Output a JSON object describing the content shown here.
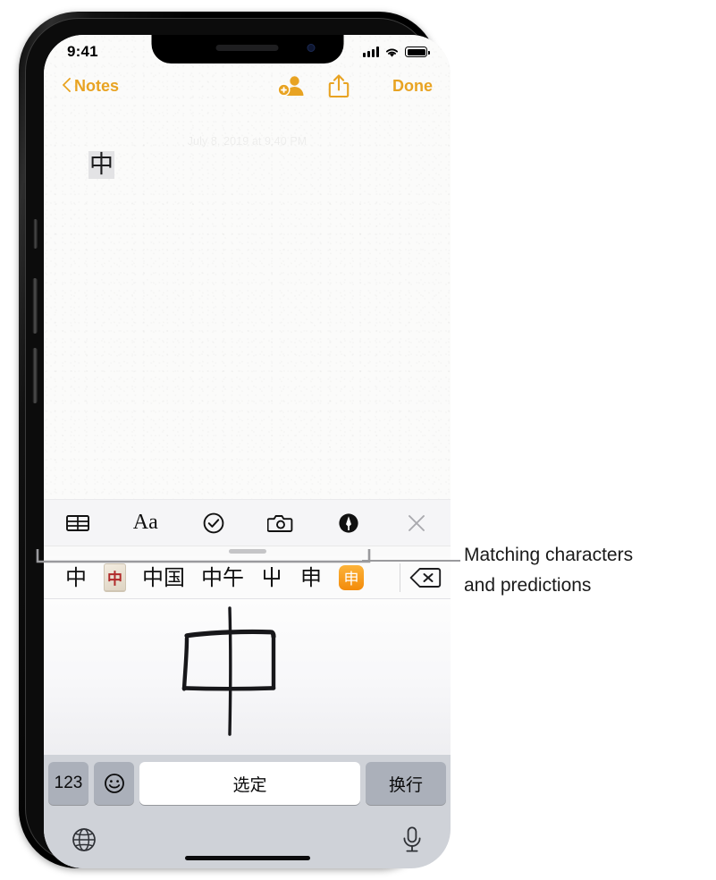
{
  "status_bar": {
    "time": "9:41",
    "signal_icon": "cellular-signal-icon",
    "wifi_icon": "wifi-icon",
    "battery_icon": "battery-icon"
  },
  "navbar": {
    "back_label": "Notes",
    "back_icon": "chevron-left-icon",
    "add_people_icon": "add-person-icon",
    "share_icon": "share-icon",
    "done_label": "Done"
  },
  "note": {
    "date": "July 8, 2019 at 9:40 PM",
    "body_text": "中"
  },
  "note_toolbar": {
    "items": [
      {
        "name": "table-icon",
        "label": ""
      },
      {
        "name": "format-icon",
        "label": "Aa"
      },
      {
        "name": "checklist-icon",
        "label": ""
      },
      {
        "name": "camera-icon",
        "label": ""
      },
      {
        "name": "markup-icon",
        "label": ""
      },
      {
        "name": "close-icon",
        "label": ""
      }
    ]
  },
  "candidate_bar": {
    "grabber": "drag-handle",
    "candidates": [
      {
        "type": "text",
        "label": "中"
      },
      {
        "type": "mahjong",
        "label": "中"
      },
      {
        "type": "text",
        "label": "中国"
      },
      {
        "type": "text",
        "label": "中午"
      },
      {
        "type": "text",
        "label": "屮"
      },
      {
        "type": "text",
        "label": "申"
      },
      {
        "type": "emoji",
        "label": "申"
      }
    ],
    "delete_icon": "delete-backward-icon"
  },
  "handwriting_pad": {
    "drawn_character": "中"
  },
  "keyboard": {
    "numeric_key": "123",
    "emoji_key_icon": "smiley-icon",
    "space_key": "选定",
    "return_key": "换行",
    "globe_icon": "globe-icon",
    "mic_icon": "microphone-icon"
  },
  "callout": {
    "line1": "Matching characters",
    "line2": "and predictions"
  },
  "colors": {
    "accent": "#E8A322",
    "emoji_orange": "#F58B0A",
    "keyboard_bg": "#CFD2D8",
    "key_gray": "#ABB0BA"
  }
}
